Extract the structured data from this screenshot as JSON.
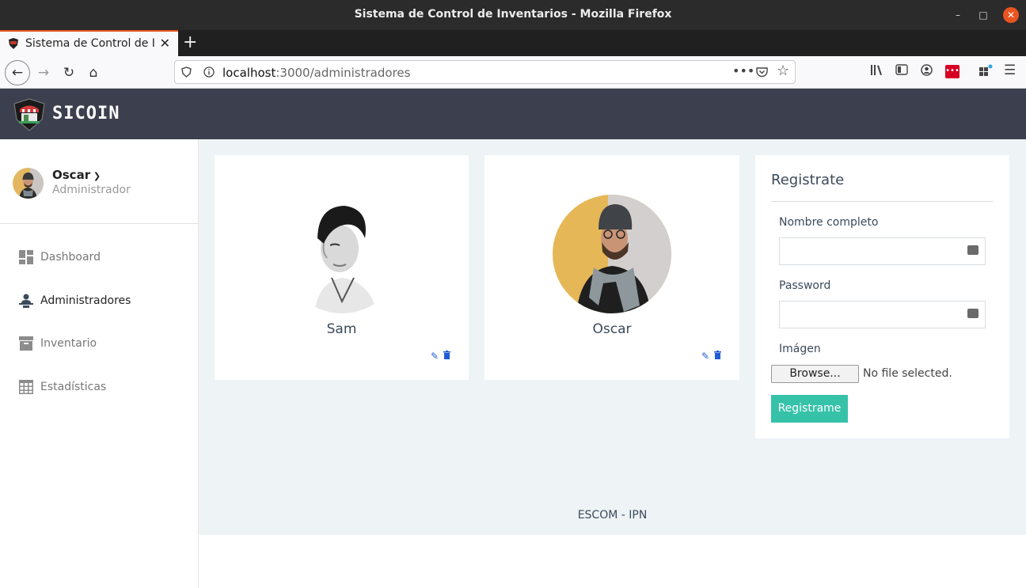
{
  "window": {
    "title": "Sistema de Control de Inventarios - Mozilla Firefox"
  },
  "tab": {
    "title": "Sistema de Control de Inventarios"
  },
  "address": {
    "host": "localhost",
    "path": ":3000/administradores"
  },
  "brand": {
    "name": "SICOIN"
  },
  "user": {
    "name": "Oscar",
    "role": "Administrador"
  },
  "menu": [
    {
      "label": "Dashboard",
      "icon": "dashboard-icon"
    },
    {
      "label": "Administradores",
      "icon": "admin-user-icon"
    },
    {
      "label": "Inventario",
      "icon": "archive-box-icon"
    },
    {
      "label": "Estadísticas",
      "icon": "table-grid-icon"
    }
  ],
  "admins": [
    {
      "name": "Sam"
    },
    {
      "name": "Oscar"
    }
  ],
  "register": {
    "title": "Registrate",
    "name_label": "Nombre completo",
    "password_label": "Password",
    "image_label": "Imágen",
    "browse_label": "Browse...",
    "no_file": "No file selected.",
    "submit_label": "Registrame"
  },
  "footer": {
    "text": "ESCOM - IPN"
  },
  "colors": {
    "header": "#3c3f4d",
    "accent": "#36c2a9",
    "content_bg": "#eef3f6",
    "icon_blue": "#1e5bd6"
  }
}
